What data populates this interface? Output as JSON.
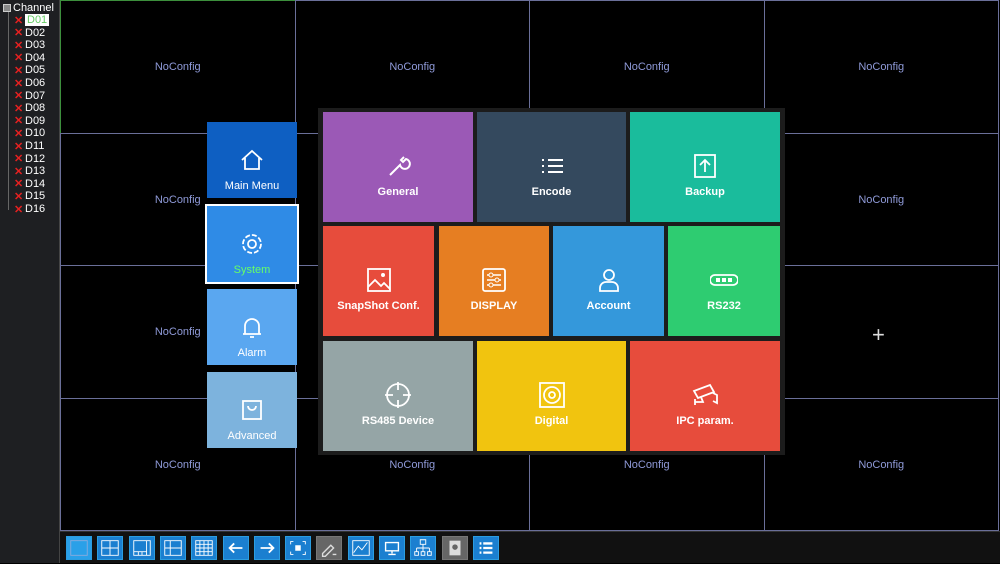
{
  "sidebar": {
    "title": "Channel",
    "channels": [
      "D01",
      "D02",
      "D03",
      "D04",
      "D05",
      "D06",
      "D07",
      "D08",
      "D09",
      "D10",
      "D11",
      "D12",
      "D13",
      "D14",
      "D15",
      "D16"
    ],
    "selected": "D01"
  },
  "grid": {
    "cell_label": "NoConfig",
    "cells": [
      "NoConfig",
      "NoConfig",
      "NoConfig",
      "NoConfig",
      "NoConfig",
      "",
      "",
      "NoConfig",
      "NoConfig",
      "",
      "",
      "",
      "NoConfig",
      "NoConfig",
      "NoConfig",
      "NoConfig"
    ]
  },
  "menu": {
    "left": [
      {
        "label": "Main Menu",
        "icon": "home-icon",
        "color": "#0e5fc2"
      },
      {
        "label": "System",
        "icon": "gear-icon",
        "color": "#2f8be6",
        "active": true
      },
      {
        "label": "Alarm",
        "icon": "bell-icon",
        "color": "#5aa7f0"
      },
      {
        "label": "Advanced",
        "icon": "bag-icon",
        "color": "#7db3dd"
      }
    ],
    "tiles": [
      {
        "label": "General",
        "icon": "wrench-icon",
        "color": "#9b59b6"
      },
      {
        "label": "Encode",
        "icon": "list-icon",
        "color": "#34495e"
      },
      {
        "label": "Backup",
        "icon": "upload-icon",
        "color": "#1abc9c"
      },
      {
        "label": "SnapShot Conf.",
        "icon": "image-icon",
        "color": "#e74c3c"
      },
      {
        "label": "DISPLAY",
        "icon": "sliders-icon",
        "color": "#e67e22"
      },
      {
        "label": "Account",
        "icon": "user-icon",
        "color": "#3498db"
      },
      {
        "label": "RS232",
        "icon": "serial-port-icon",
        "color": "#2ecc71"
      },
      {
        "label": "RS485 Device",
        "icon": "crosshair-icon",
        "color": "#95a5a6"
      },
      {
        "label": "Digital",
        "icon": "disk-icon",
        "color": "#f1c40f"
      },
      {
        "label": "IPC param.",
        "icon": "camera-icon",
        "color": "#e74c3c"
      }
    ]
  },
  "toolbar": [
    "single-view-icon",
    "quad-view-icon",
    "8-view-icon",
    "9-view-icon",
    "16-view-icon",
    "previous-icon",
    "next-icon",
    "fullscreen-icon",
    "edit-icon",
    "chart-icon",
    "monitor-icon",
    "network-icon",
    "hdd-icon",
    "menu-list-icon"
  ]
}
